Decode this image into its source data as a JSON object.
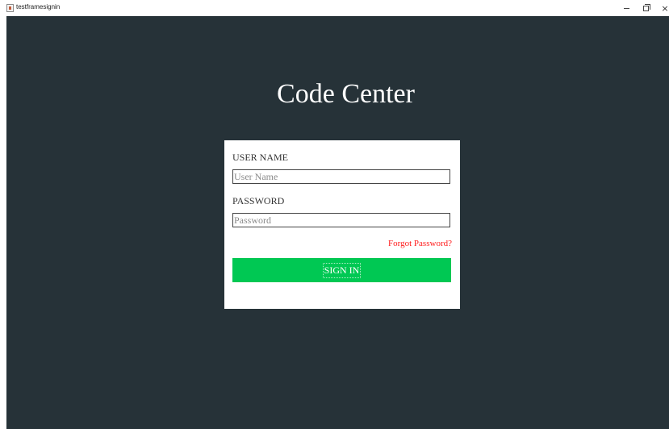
{
  "window": {
    "title": "testframesignin",
    "minimize_glyph": "–",
    "close_glyph": "×"
  },
  "header": {
    "title": "Code Center"
  },
  "form": {
    "username_label": "USER NAME",
    "username_placeholder": "User Name",
    "username_value": "",
    "password_label": "PASSWORD",
    "password_placeholder": "Password",
    "password_value": "",
    "forgot_label": "Forgot Password?",
    "signin_label": "SIGN IN"
  },
  "colors": {
    "background": "#263238",
    "card": "#ffffff",
    "accent_button": "#00c853",
    "link": "#ff1a1a",
    "title_text": "#ffffff"
  },
  "icons": {
    "app": "java-app-icon",
    "minimize": "minimize-icon",
    "maximize": "maximize-icon",
    "close": "close-icon"
  }
}
